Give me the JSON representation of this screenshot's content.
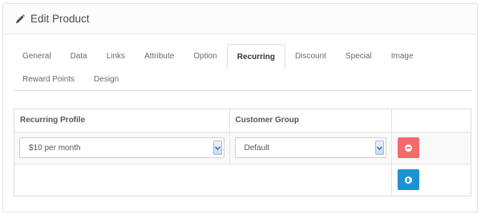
{
  "panel": {
    "title": "Edit Product",
    "icon": "pencil-icon"
  },
  "tabs": {
    "row1": [
      {
        "label": "General",
        "active": false
      },
      {
        "label": "Data",
        "active": false
      },
      {
        "label": "Links",
        "active": false
      },
      {
        "label": "Attribute",
        "active": false
      },
      {
        "label": "Option",
        "active": false
      },
      {
        "label": "Recurring",
        "active": true
      },
      {
        "label": "Discount",
        "active": false
      },
      {
        "label": "Special",
        "active": false
      },
      {
        "label": "Image",
        "active": false
      }
    ],
    "row2": [
      {
        "label": "Reward Points",
        "active": false
      },
      {
        "label": "Design",
        "active": false
      }
    ]
  },
  "recurring_table": {
    "headers": {
      "profile": "Recurring Profile",
      "group": "Customer Group",
      "action": ""
    },
    "rows": [
      {
        "profile_value": "$10 per month",
        "group_value": "Default",
        "remove_icon": "minus-circle-icon"
      }
    ],
    "add_icon": "plus-circle-icon"
  },
  "colors": {
    "danger": "#f56b6b",
    "primary": "#1e91cf",
    "border": "#dcdcdc"
  }
}
